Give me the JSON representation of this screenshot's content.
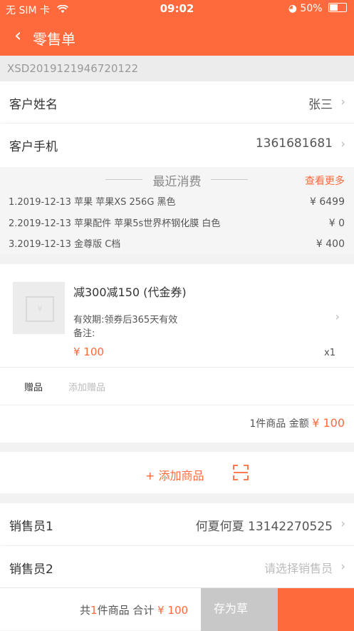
{
  "status": {
    "carrier": "无 SIM 卡",
    "time": "09:02",
    "battery": "50%"
  },
  "nav": {
    "back_icon": "chevron-left-icon",
    "title": "零售单"
  },
  "order_no": "XSD2019121946720122",
  "customer": {
    "name_label": "客户姓名",
    "name_value": "张三",
    "phone_label": "客户手机",
    "phone_value": "1361681681"
  },
  "recent": {
    "title": "最近消费",
    "more": "查看更多",
    "items": [
      {
        "text": "1.2019-12-13 苹果 苹果XS 256G 黑色",
        "price": "¥ 6499"
      },
      {
        "text": "2.2019-12-13 苹果配件 苹果5s世界杯钢化膜 白色",
        "price": "¥ 0"
      },
      {
        "text": "3.2019-12-13 金尊版 C档",
        "price": "¥ 400"
      }
    ]
  },
  "product": {
    "name": "减300减150 (代金券)",
    "validity": "有效期:领券后365天有效",
    "note": "备注:",
    "price": "¥ 100",
    "qty": "x1",
    "thumb_symbol": "¥"
  },
  "gift": {
    "label": "赠品",
    "add": "添加赠品"
  },
  "summary": {
    "count": "1件商品",
    "amount_label": "金额",
    "amount": "¥ 100"
  },
  "add_product": "+ 添加商品",
  "sales": {
    "s1_label": "销售员1",
    "s1_value": "何夏何夏 13142270525",
    "s2_label": "销售员2",
    "s2_placeholder": "请选择销售员"
  },
  "bottom": {
    "total_prefix": "共",
    "total_count": "1",
    "total_mid": "件商品 合计",
    "total_amount": "¥ 100",
    "draft": "存为草"
  },
  "colors": {
    "accent": "#ff6a3d"
  }
}
